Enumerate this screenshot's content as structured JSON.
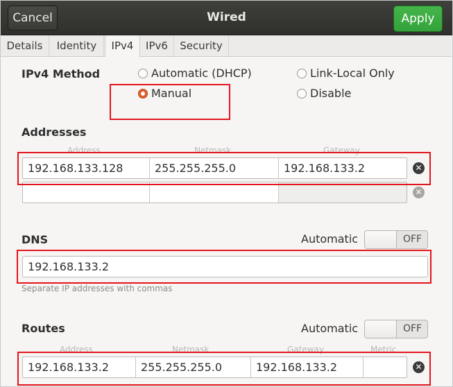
{
  "header": {
    "cancel": "Cancel",
    "title": "Wired",
    "apply": "Apply"
  },
  "tabs": [
    {
      "label": "Details"
    },
    {
      "label": "Identity"
    },
    {
      "label": "IPv4"
    },
    {
      "label": "IPv6"
    },
    {
      "label": "Security"
    }
  ],
  "ipv4": {
    "method_label": "IPv4 Method",
    "options": {
      "automatic": "Automatic (DHCP)",
      "link_local": "Link-Local Only",
      "manual": "Manual",
      "disable": "Disable"
    },
    "selected": "Manual"
  },
  "addresses": {
    "title": "Addresses",
    "columns": [
      "Address",
      "Netmask",
      "Gateway"
    ],
    "rows": [
      {
        "address": "192.168.133.128",
        "netmask": "255.255.255.0",
        "gateway": "192.168.133.2"
      },
      {
        "address": "",
        "netmask": "",
        "gateway": ""
      }
    ]
  },
  "dns": {
    "title": "DNS",
    "automatic_label": "Automatic",
    "switch": "OFF",
    "value": "192.168.133.2",
    "hint": "Separate IP addresses with commas"
  },
  "routes": {
    "title": "Routes",
    "automatic_label": "Automatic",
    "switch": "OFF",
    "columns": [
      "Address",
      "Netmask",
      "Gateway",
      "Metric"
    ],
    "rows": [
      {
        "address": "192.168.133.2",
        "netmask": "255.255.255.0",
        "gateway": "192.168.133.2",
        "metric": ""
      }
    ]
  },
  "colors": {
    "accent_green": "#3aa93f",
    "radio_selected": "#e0622a",
    "annotation_red": "#e3141b"
  }
}
